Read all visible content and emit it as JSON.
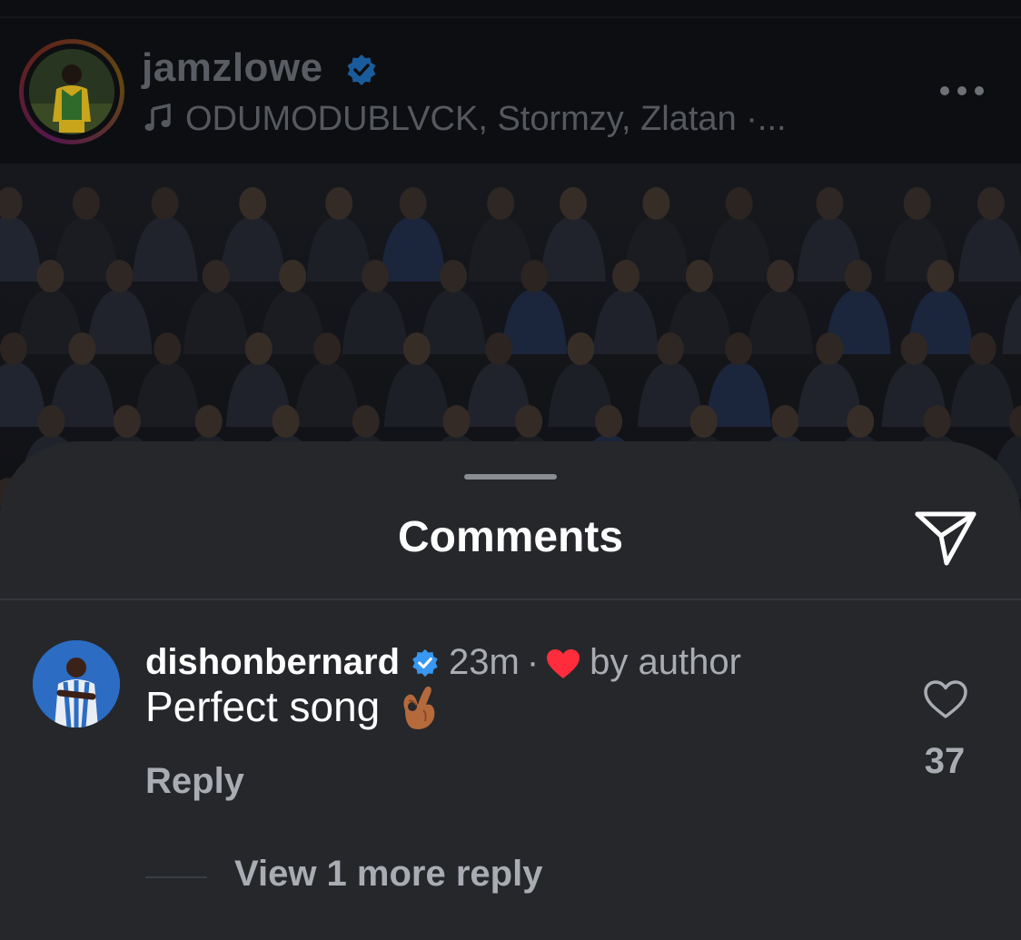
{
  "post": {
    "username": "jamzlowe",
    "music": "ODUMODUBLVCK, Stormzy, Zlatan ·...",
    "icons": {
      "verified": "verified-badge-icon",
      "music": "music-note-icon",
      "more": "more-horizontal-icon"
    }
  },
  "comments_sheet": {
    "title": "Comments",
    "share_icon": "paper-plane-icon",
    "comments": [
      {
        "username": "dishonbernard",
        "verified": true,
        "time": "23m",
        "separator": "·",
        "liked_by_author_label": "by author",
        "text": "Perfect song",
        "emoji": "ok-hand-emoji",
        "reply_label": "Reply",
        "like_count": "37",
        "view_replies_label": "View 1 more reply"
      }
    ]
  },
  "colors": {
    "sheet_background": "#25272b",
    "verified_blue": "#3897f0",
    "heart_red": "#ff2d3b",
    "secondary_text": "#a9acb2"
  }
}
